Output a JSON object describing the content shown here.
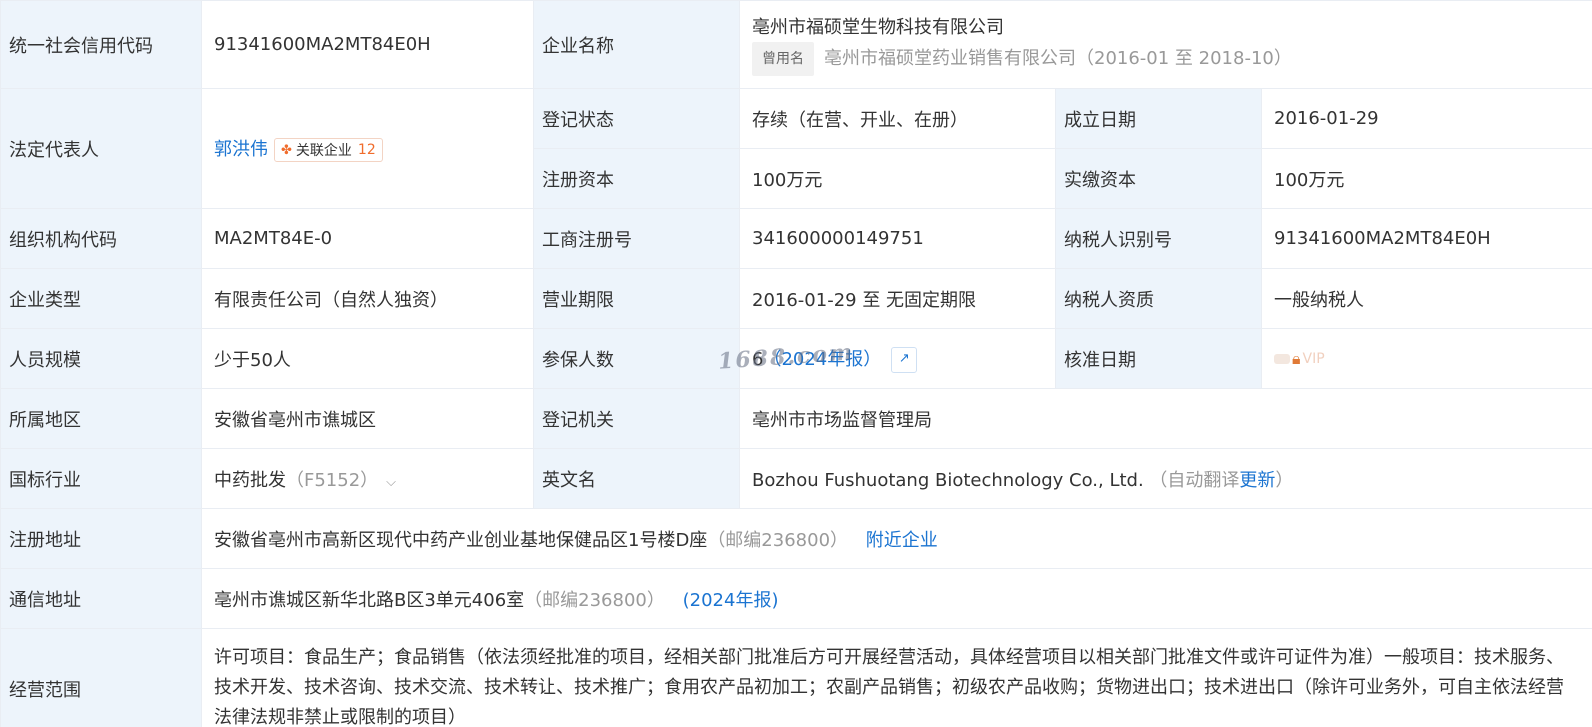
{
  "rows": {
    "credit_code": {
      "label": "统一社会信用代码",
      "value": "91341600MA2MT84E0H"
    },
    "company_name": {
      "label": "企业名称",
      "value": "亳州市福硕堂生物科技有限公司",
      "used_name_tag": "曾用名",
      "used_name": "亳州市福硕堂药业销售有限公司",
      "used_name_period": "（2016-01 至 2018-10）"
    },
    "legal_rep": {
      "label": "法定代表人",
      "name": "郭洪伟",
      "related_label": "关联企业",
      "related_count": "12"
    },
    "reg_status": {
      "label": "登记状态",
      "value": "存续（在营、开业、在册）"
    },
    "founded": {
      "label": "成立日期",
      "value": "2016-01-29"
    },
    "reg_capital": {
      "label": "注册资本",
      "value": "100万元"
    },
    "paid_capital": {
      "label": "实缴资本",
      "value": "100万元"
    },
    "org_code": {
      "label": "组织机构代码",
      "value": "MA2MT84E-0"
    },
    "biz_reg_no": {
      "label": "工商注册号",
      "value": "341600000149751"
    },
    "taxpayer_id": {
      "label": "纳税人识别号",
      "value": "91341600MA2MT84E0H"
    },
    "company_type": {
      "label": "企业类型",
      "value": "有限责任公司（自然人独资）"
    },
    "biz_term": {
      "label": "营业期限",
      "value": "2016-01-29 至 无固定期限"
    },
    "taxpayer_qual": {
      "label": "纳税人资质",
      "value": "一般纳税人"
    },
    "staff_size": {
      "label": "人员规模",
      "value": "少于50人"
    },
    "insured": {
      "label": "参保人数",
      "value": "6",
      "report": "（2024年报）"
    },
    "approve_date": {
      "label": "核准日期",
      "vip": "VIP"
    },
    "region": {
      "label": "所属地区",
      "value": "安徽省亳州市谯城区"
    },
    "reg_authority": {
      "label": "登记机关",
      "value": "亳州市市场监督管理局"
    },
    "industry": {
      "label": "国标行业",
      "value": "中药批发",
      "code": "（F5152）"
    },
    "english_name": {
      "label": "英文名",
      "value": "Bozhou Fushuotang Biotechnology Co., Ltd.",
      "note_open": "（自动翻译",
      "update": "更新",
      "note_close": "）"
    },
    "reg_address": {
      "label": "注册地址",
      "value": "安徽省亳州市高新区现代中药产业创业基地保健品区1号楼D座",
      "postcode": "（邮编236800）",
      "nearby": "附近企业"
    },
    "mail_address": {
      "label": "通信地址",
      "value": "亳州市谯城区新华北路B区3单元406室",
      "postcode": "（邮编236800）",
      "report": "(2024年报)"
    },
    "scope": {
      "label": "经营范围",
      "value": "许可项目：食品生产；食品销售（依法须经批准的项目，经相关部门批准后方可开展经营活动，具体经营项目以相关部门批准文件或许可证件为准）一般项目：技术服务、技术开发、技术咨询、技术交流、技术转让、技术推广；食用农产品初加工；农副产品销售；初级农产品收购；货物进出口；技术进出口（除许可业务外，可自主依法经营法律法规非禁止或限制的项目）"
    }
  },
  "watermark": "1688.com",
  "icons": {
    "related": "related-company-icon",
    "chart": "trend-chart-icon",
    "lock": "lock-icon",
    "chevron": "chevron-down-icon"
  },
  "colors": {
    "label_bg": "#edf4fb",
    "link": "#1b74d1",
    "accent": "#f06c2c",
    "border": "#e9edf3"
  }
}
